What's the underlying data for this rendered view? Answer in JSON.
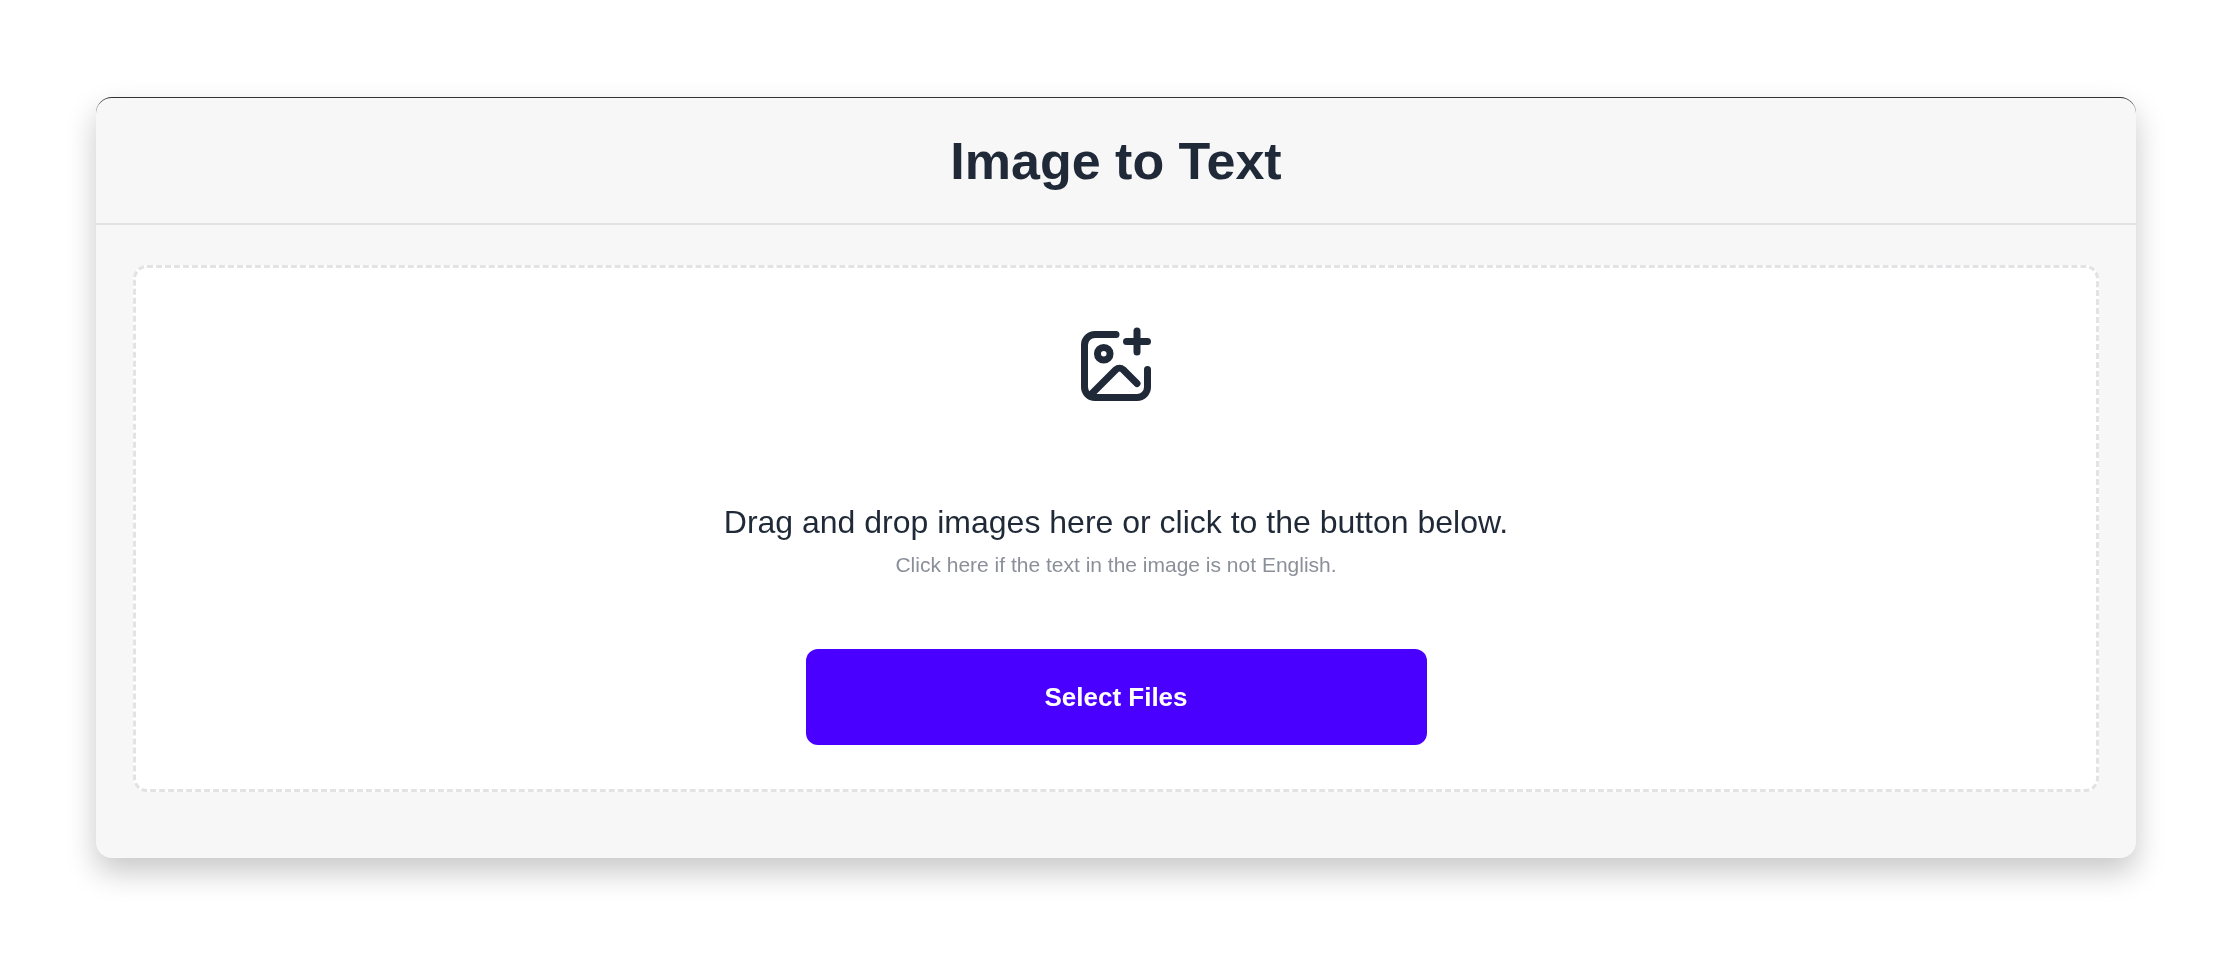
{
  "header": {
    "title": "Image to Text"
  },
  "dropzone": {
    "instruction": "Drag and drop images here or click to the button below.",
    "language_link": "Click here if the text in the image is not English.",
    "button": "Select Files"
  }
}
